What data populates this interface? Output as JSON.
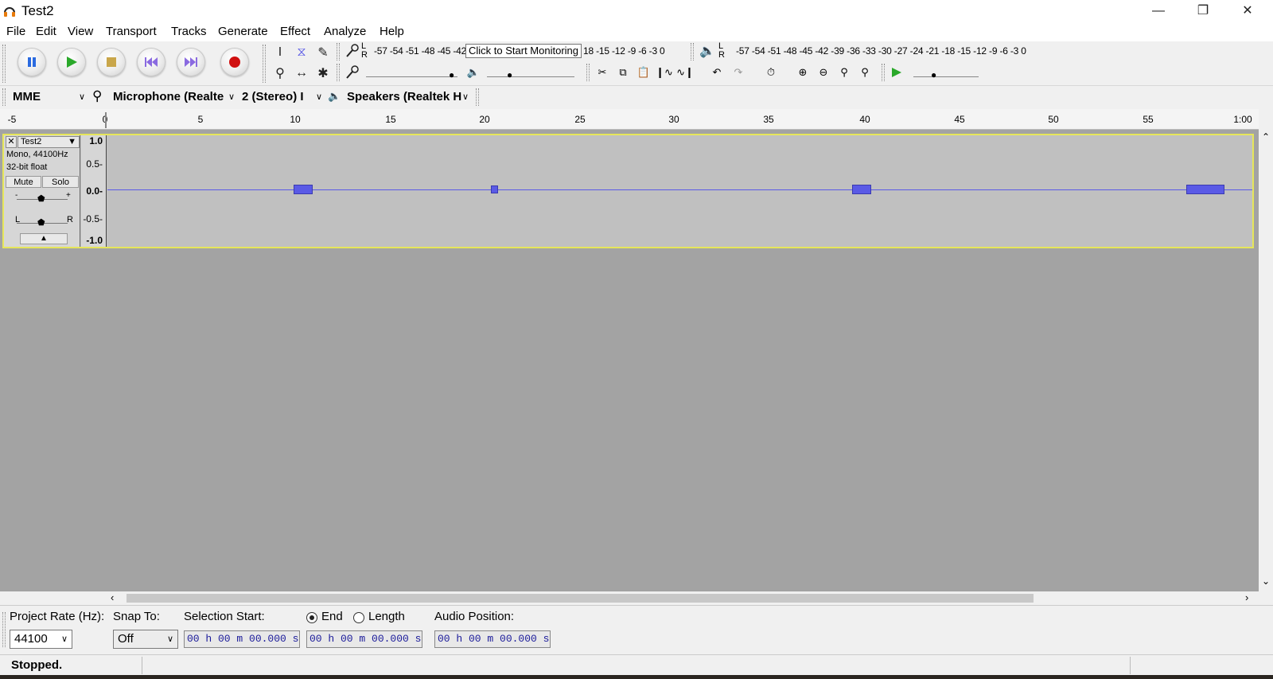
{
  "window": {
    "title": "Test2"
  },
  "menu": [
    "File",
    "Edit",
    "View",
    "Transport",
    "Tracks",
    "Generate",
    "Effect",
    "Analyze",
    "Help"
  ],
  "recording_meter": {
    "channels": "L\nR",
    "scale_left": "-57 -54 -51 -48 -45 -42",
    "tooltip": "Click to Start Monitoring",
    "scale_right": "18 -15 -12  -9  -6  -3  0"
  },
  "playback_meter": {
    "scale": "-57 -54 -51 -48 -45 -42 -39 -36 -33 -30 -27 -24 -21 -18 -15 -12  -9  -6  -3  0"
  },
  "device_toolbar": {
    "host": "MME",
    "recording_device": "Microphone (Realte",
    "channels": "2 (Stereo) I",
    "playback_device": "Speakers (Realtek H"
  },
  "ruler": {
    "ticks": [
      "-5",
      "0",
      "5",
      "10",
      "15",
      "20",
      "25",
      "30",
      "35",
      "40",
      "45",
      "50",
      "55",
      "1:00"
    ]
  },
  "track": {
    "name": "Test2",
    "info_line1": "Mono, 44100Hz",
    "info_line2": "32-bit float",
    "mute_label": "Mute",
    "solo_label": "Solo",
    "gain_minus": "-",
    "gain_plus": "+",
    "pan_left": "L",
    "pan_right": "R",
    "scale": [
      "1.0",
      "0.5-",
      "0.0-",
      "-0.5-",
      "-1.0"
    ]
  },
  "selection_toolbar": {
    "project_rate_label": "Project Rate (Hz):",
    "project_rate_value": "44100",
    "snap_to_label": "Snap To:",
    "snap_to_value": "Off",
    "selection_start_label": "Selection Start:",
    "end_label": "End",
    "length_label": "Length",
    "audio_position_label": "Audio Position:",
    "selection_start_time": "00 h 00 m 00.000 s",
    "selection_end_time": "00 h 00 m 00.000 s",
    "audio_position_time": "00 h 00 m 00.000 s",
    "end_selected": true
  },
  "status": {
    "text": "Stopped."
  },
  "colors": {
    "waveform": "#5a5ae6",
    "track_border": "#e6e65a",
    "record": "#d01010",
    "play": "#2aa82a",
    "pause": "#2a6ae0"
  }
}
